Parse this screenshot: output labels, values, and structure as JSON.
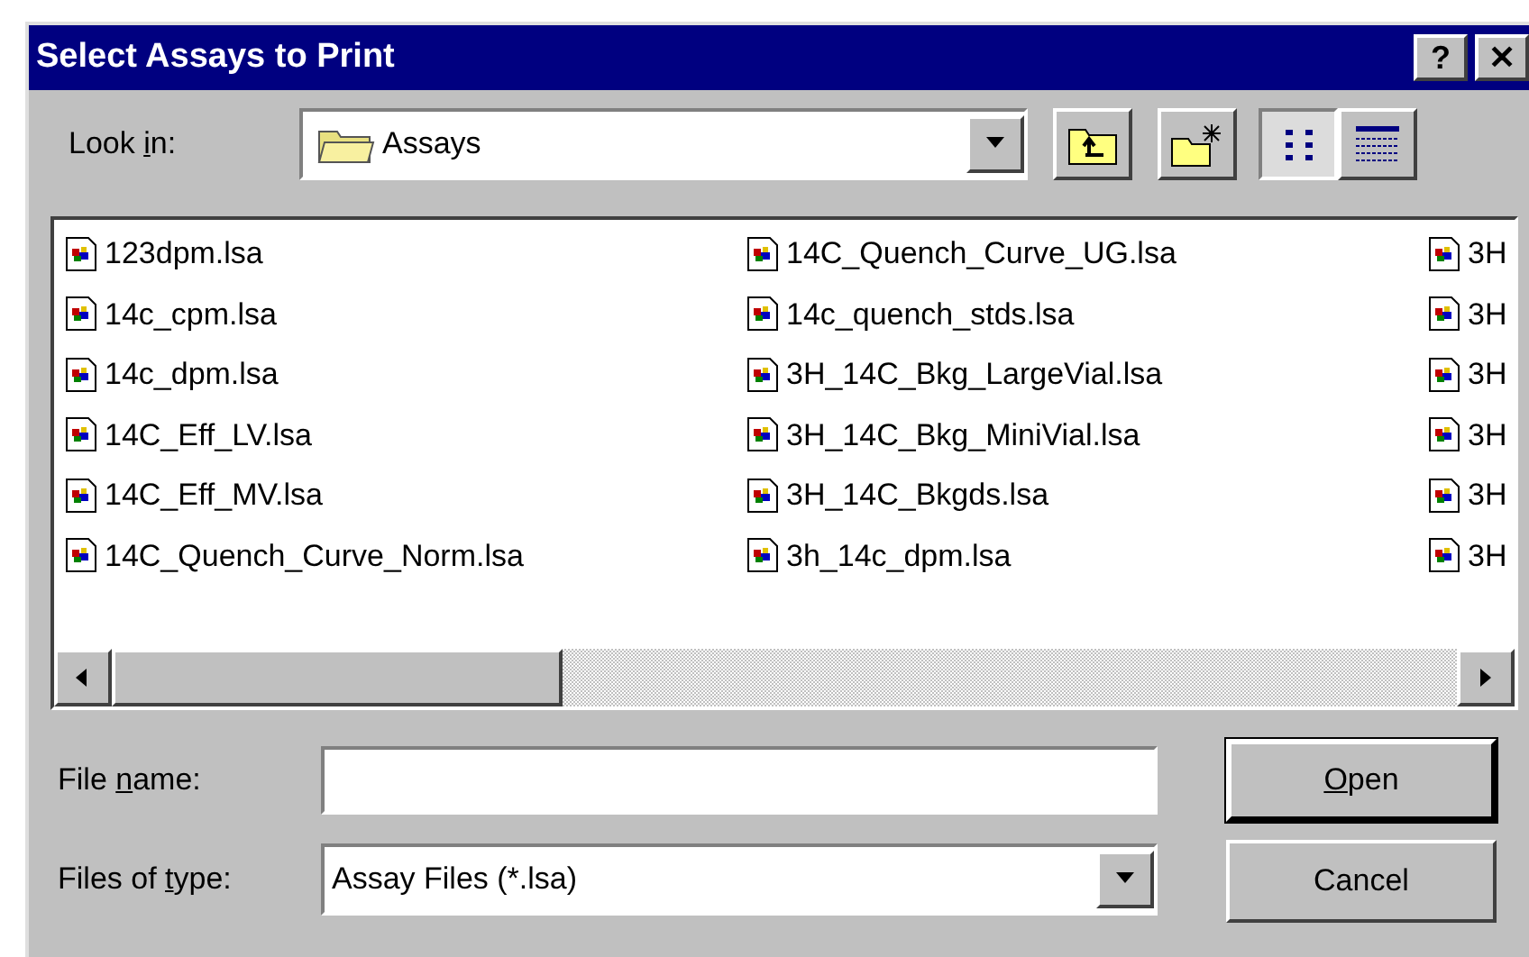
{
  "window": {
    "title": "Select Assays to Print",
    "help_button": "?",
    "close_button": "✕"
  },
  "look_in": {
    "label_parts": [
      {
        "text": "Look ",
        "underline": false
      },
      {
        "text": "i",
        "underline": true
      },
      {
        "text": "n:",
        "underline": false
      }
    ],
    "value": "Assays"
  },
  "files": [
    {
      "name": "123dpm.lsa"
    },
    {
      "name": "14c_cpm.lsa"
    },
    {
      "name": "14c_dpm.lsa"
    },
    {
      "name": "14C_Eff_LV.lsa"
    },
    {
      "name": "14C_Eff_MV.lsa"
    },
    {
      "name": "14C_Quench_Curve_Norm.lsa"
    },
    {
      "name": "14C_Quench_Curve_UG.lsa"
    },
    {
      "name": "14c_quench_stds.lsa"
    },
    {
      "name": "3H_14C_Bkg_LargeVial.lsa"
    },
    {
      "name": "3H_14C_Bkg_MiniVial.lsa"
    },
    {
      "name": "3H_14C_Bkgds.lsa"
    },
    {
      "name": "3h_14c_dpm.lsa"
    },
    {
      "name": "3H"
    },
    {
      "name": "3H"
    },
    {
      "name": "3H"
    },
    {
      "name": "3H"
    },
    {
      "name": "3H"
    },
    {
      "name": "3H"
    }
  ],
  "file_name": {
    "label_parts": [
      {
        "text": "File ",
        "underline": false
      },
      {
        "text": "n",
        "underline": true
      },
      {
        "text": "ame:",
        "underline": false
      }
    ]
  },
  "files_of_type": {
    "label_parts": [
      {
        "text": "Files of ",
        "underline": false
      },
      {
        "text": "t",
        "underline": true
      },
      {
        "text": "ype:",
        "underline": false
      }
    ],
    "value": "Assay Files (*.lsa)"
  },
  "buttons": [
    {
      "label_parts": [
        {
          "text": "O",
          "underline": true
        },
        {
          "text": "pen",
          "underline": false
        }
      ],
      "default": true
    },
    {
      "label_parts": [
        {
          "text": "Cancel",
          "underline": false
        }
      ],
      "default": false
    }
  ]
}
